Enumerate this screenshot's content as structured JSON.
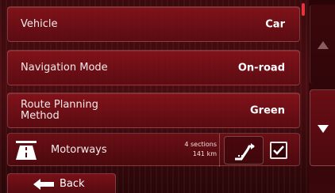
{
  "settings": {
    "rows": [
      {
        "label": "Vehicle",
        "value": "Car"
      },
      {
        "label": "Navigation Mode",
        "value": "On-road"
      },
      {
        "label": "Route Planning Method",
        "value": "Green"
      }
    ],
    "motorways": {
      "label": "Motorways",
      "sections": "4 sections",
      "distance": "141 km",
      "avoid_icon": "road-avoid-icon",
      "checked": true
    }
  },
  "footer": {
    "back_label": "Back"
  },
  "scrollbar": {
    "up_icon": "scroll-up-arrow-icon",
    "down_icon": "scroll-down-arrow-icon"
  },
  "colors": {
    "accent": "#e8323c",
    "background": "#3a0a0d"
  }
}
